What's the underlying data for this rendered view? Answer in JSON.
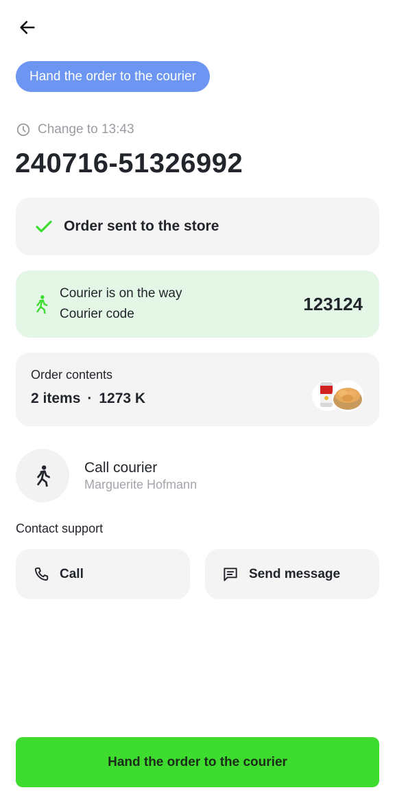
{
  "header": {
    "back_icon": "arrow-left-icon",
    "status_label": "Hand the order to the courier"
  },
  "order": {
    "time_change": "Change to 13:43",
    "number": "240716-51326992"
  },
  "status_card": {
    "label": "Order sent to the store",
    "icon": "check-icon",
    "icon_color": "#3ddc2e"
  },
  "courier_card": {
    "line1": "Courier is on the way",
    "line2": "Courier code",
    "code": "123124",
    "icon": "walking-person-icon",
    "bg_color": "#e4f7e7"
  },
  "contents_card": {
    "title": "Order contents",
    "items": "2 items",
    "separator": "·",
    "total": "1273 K",
    "thumbnails": [
      "soup-can-thumbnail",
      "bread-basket-thumbnail"
    ]
  },
  "call_courier": {
    "title": "Call courier",
    "name": "Marguerite Hofmann",
    "icon": "walking-person-icon"
  },
  "support": {
    "title": "Contact support",
    "call_label": "Call",
    "message_label": "Send message"
  },
  "cta": {
    "label": "Hand the order to the courier",
    "color": "#3ddc2e"
  },
  "colors": {
    "pill": "#6d95f2",
    "card_bg": "#f4f4f5",
    "text": "#22252b",
    "muted": "#9a9ca2"
  }
}
